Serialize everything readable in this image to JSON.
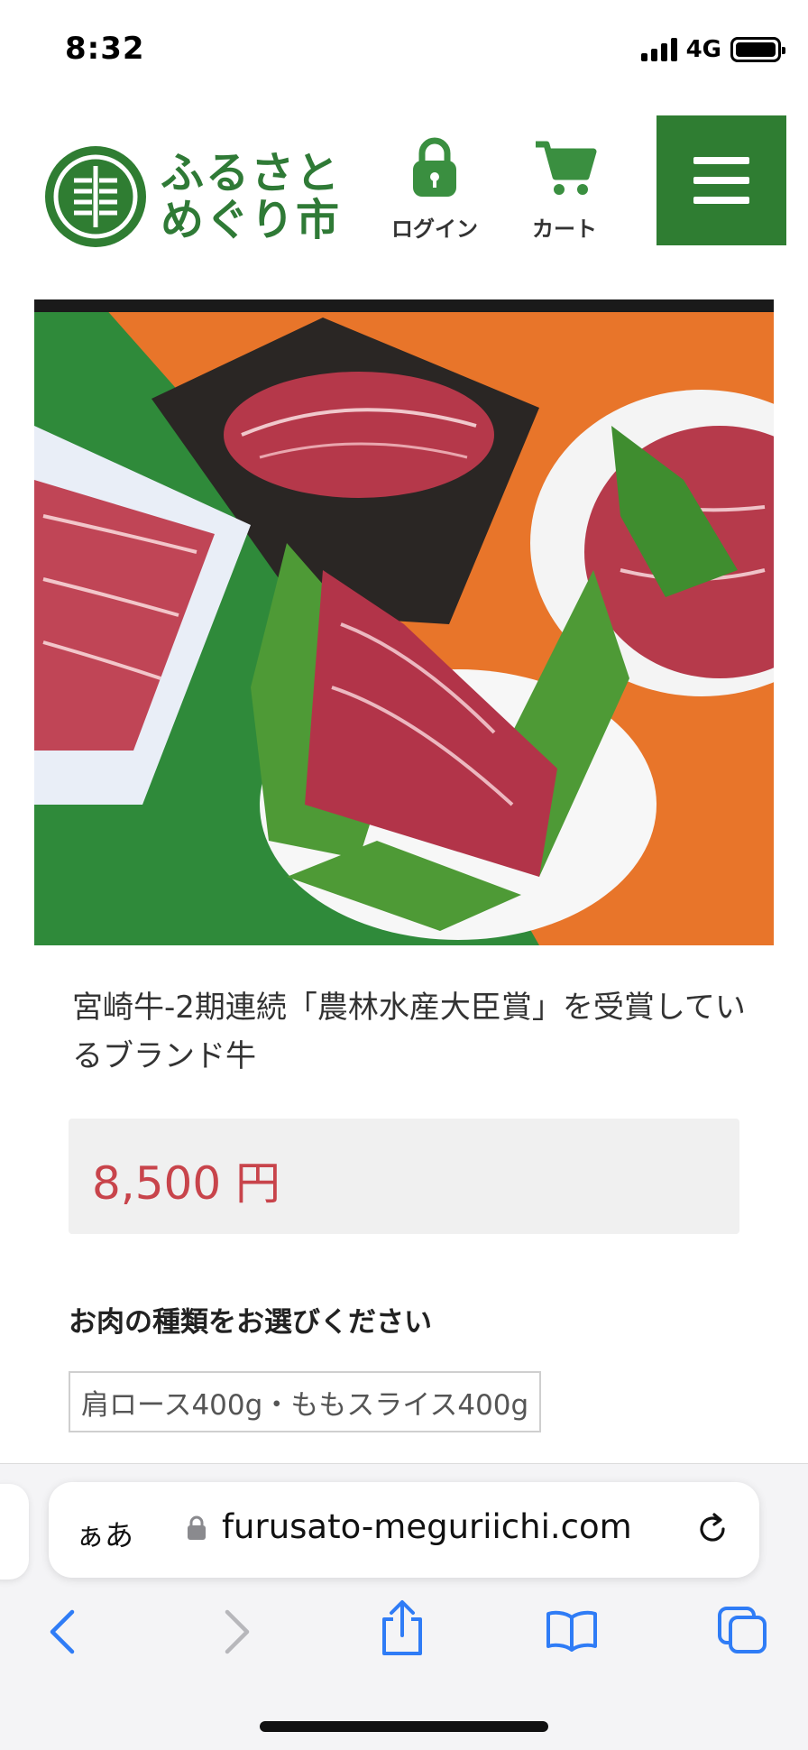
{
  "status_bar": {
    "time": "8:32",
    "network": "4G"
  },
  "header": {
    "logo_line1": "ふるさと",
    "logo_line2": "めぐり市",
    "login_label": "ログイン",
    "cart_label": "カート",
    "brand_color": "#2f7d32"
  },
  "product": {
    "title": "宮崎牛-2期連続「農林水産大臣賞」を受賞しているブランド牛",
    "price": "8,500 円",
    "option_label": "お肉の種類をお選びください",
    "option_selected": "肩ロース400g・ももスライス400g",
    "price_color": "#c8444b"
  },
  "browser": {
    "text_size_label": "ぁあ",
    "url": "furusato-meguriichi.com",
    "tint": "#2f7cf6"
  }
}
